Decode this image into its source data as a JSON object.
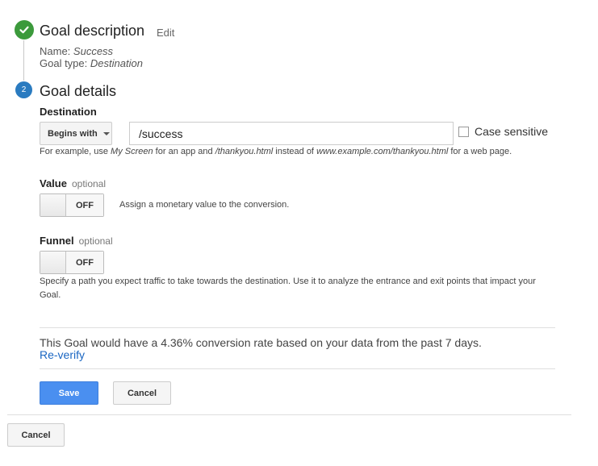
{
  "goal_description": {
    "title": "Goal description",
    "edit_label": "Edit",
    "name_label": "Name:",
    "name_value": "Success",
    "type_label": "Goal type:",
    "type_value": "Destination"
  },
  "goal_details": {
    "step_number": "2",
    "title": "Goal details",
    "destination_label": "Destination",
    "match_type": "Begins with",
    "destination_value": "/success",
    "case_sensitive_label": "Case sensitive",
    "hint": {
      "p1": "For example, use ",
      "i1": "My Screen",
      "p2": " for an app and ",
      "i2": "/thankyou.html",
      "p3": " instead of ",
      "i3": "www.example.com/thankyou.html",
      "p4": " for a web page."
    }
  },
  "value": {
    "label": "Value",
    "optional": "optional",
    "toggle_state": "OFF",
    "description": "Assign a monetary value to the conversion."
  },
  "funnel": {
    "label": "Funnel",
    "optional": "optional",
    "toggle_state": "OFF",
    "description_line1": "Specify a path you expect traffic to take towards the destination. Use it to analyze the entrance and exit points that impact your",
    "description_line2": "Goal."
  },
  "verification": {
    "text": "This Goal would have a 4.36% conversion rate based on your data from the past 7 days.",
    "reverify": "Re-verify"
  },
  "actions": {
    "save": "Save",
    "cancel": "Cancel",
    "outer_cancel": "Cancel"
  },
  "colors": {
    "check": "#3c9a3c",
    "step": "#2a7bc0",
    "primary": "#4a8ff0",
    "link": "#1a66c2"
  }
}
